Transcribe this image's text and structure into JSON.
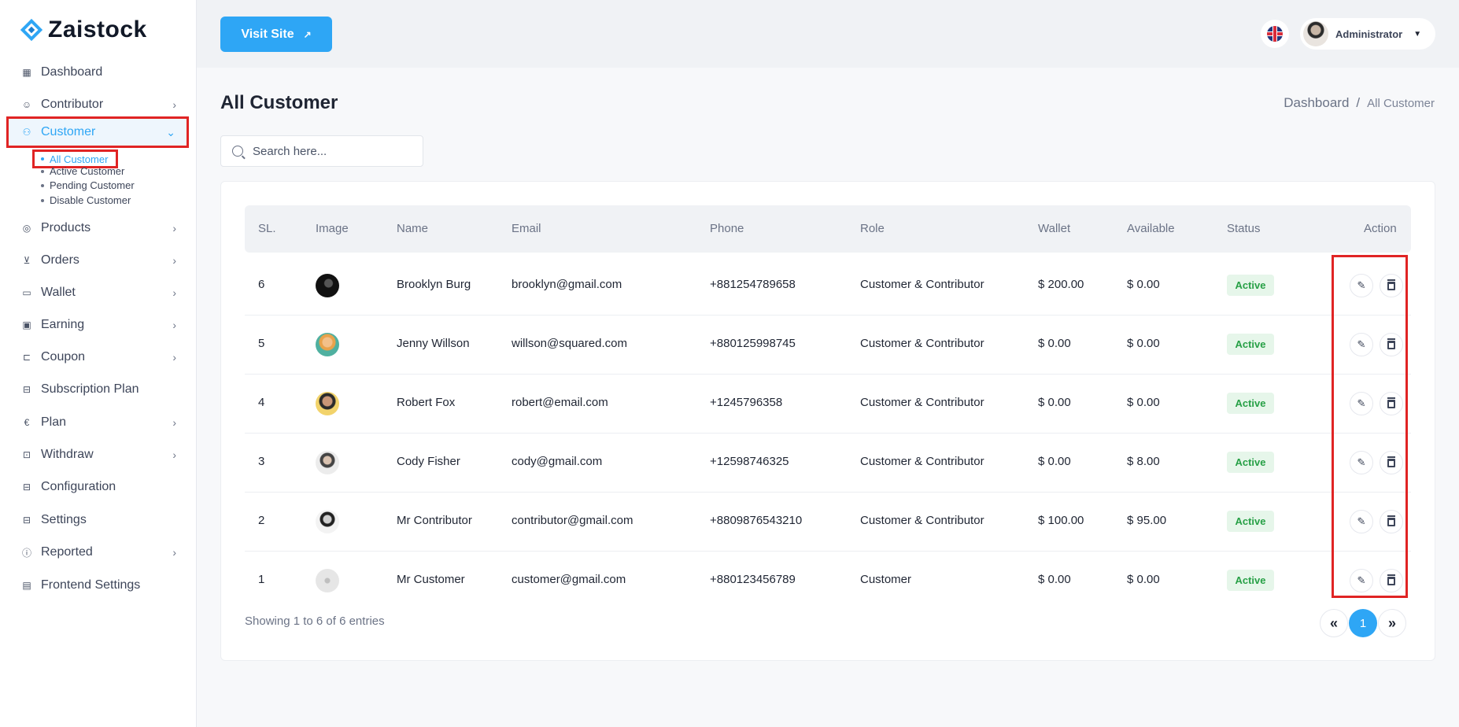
{
  "brand": {
    "name": "Zaistock"
  },
  "sidebar": {
    "items": [
      {
        "label": "Dashboard",
        "icon": "dashboard-icon",
        "chevron": false
      },
      {
        "label": "Contributor",
        "icon": "contributor-icon",
        "chevron": true
      },
      {
        "label": "Customer",
        "icon": "customer-icon",
        "chevron": true,
        "active": true
      },
      {
        "label": "Products",
        "icon": "products-icon",
        "chevron": true
      },
      {
        "label": "Orders",
        "icon": "cart-icon",
        "chevron": true
      },
      {
        "label": "Wallet",
        "icon": "wallet-icon",
        "chevron": true
      },
      {
        "label": "Earning",
        "icon": "earning-icon",
        "chevron": true
      },
      {
        "label": "Coupon",
        "icon": "coupon-icon",
        "chevron": true
      },
      {
        "label": "Subscription Plan",
        "icon": "subscription-icon",
        "chevron": false
      },
      {
        "label": "Plan",
        "icon": "plan-icon",
        "chevron": true
      },
      {
        "label": "Withdraw",
        "icon": "withdraw-icon",
        "chevron": true
      },
      {
        "label": "Configuration",
        "icon": "configuration-icon",
        "chevron": false
      },
      {
        "label": "Settings",
        "icon": "settings-icon",
        "chevron": false
      },
      {
        "label": "Reported",
        "icon": "reported-icon",
        "chevron": true
      },
      {
        "label": "Frontend Settings",
        "icon": "frontend-settings-icon",
        "chevron": false
      }
    ],
    "customer_sub": [
      "All Customer",
      "Active Customer",
      "Pending Customer",
      "Disable Customer"
    ]
  },
  "topbar": {
    "visit_site": "Visit Site",
    "user_name": "Administrator",
    "language_icon": "uk-flag-icon"
  },
  "page": {
    "title": "All Customer",
    "breadcrumb": {
      "home": "Dashboard",
      "sep": "/",
      "current": "All Customer"
    }
  },
  "search": {
    "placeholder": "Search here..."
  },
  "table": {
    "headers": [
      "SL.",
      "Image",
      "Name",
      "Email",
      "Phone",
      "Role",
      "Wallet",
      "Available",
      "Status",
      "Action"
    ],
    "rows": [
      {
        "sl": "6",
        "name": "Brooklyn Burg",
        "email": "brooklyn@gmail.com",
        "phone": "+881254789658",
        "role": "Customer & Contributor",
        "wallet": "$ 200.00",
        "available": "$ 0.00",
        "status": "Active"
      },
      {
        "sl": "5",
        "name": "Jenny Willson",
        "email": "willson@squared.com",
        "phone": "+880125998745",
        "role": "Customer & Contributor",
        "wallet": "$ 0.00",
        "available": "$ 0.00",
        "status": "Active"
      },
      {
        "sl": "4",
        "name": "Robert Fox",
        "email": "robert@email.com",
        "phone": "+1245796358",
        "role": "Customer & Contributor",
        "wallet": "$ 0.00",
        "available": "$ 0.00",
        "status": "Active"
      },
      {
        "sl": "3",
        "name": "Cody Fisher",
        "email": "cody@gmail.com",
        "phone": "+12598746325",
        "role": "Customer & Contributor",
        "wallet": "$ 0.00",
        "available": "$ 8.00",
        "status": "Active"
      },
      {
        "sl": "2",
        "name": "Mr Contributor",
        "email": "contributor@gmail.com",
        "phone": "+8809876543210",
        "role": "Customer & Contributor",
        "wallet": "$ 100.00",
        "available": "$ 95.00",
        "status": "Active"
      },
      {
        "sl": "1",
        "name": "Mr Customer",
        "email": "customer@gmail.com",
        "phone": "+880123456789",
        "role": "Customer",
        "wallet": "$ 0.00",
        "available": "$ 0.00",
        "status": "Active"
      }
    ]
  },
  "footer": {
    "info": "Showing 1 to 6 of 6 entries",
    "current_page": "1",
    "prev": "«",
    "next": "»"
  },
  "colors": {
    "accent": "#2ea6f5",
    "active_badge_bg": "#e6f6ea",
    "active_badge_text": "#27a046",
    "highlight": "#e02424"
  }
}
